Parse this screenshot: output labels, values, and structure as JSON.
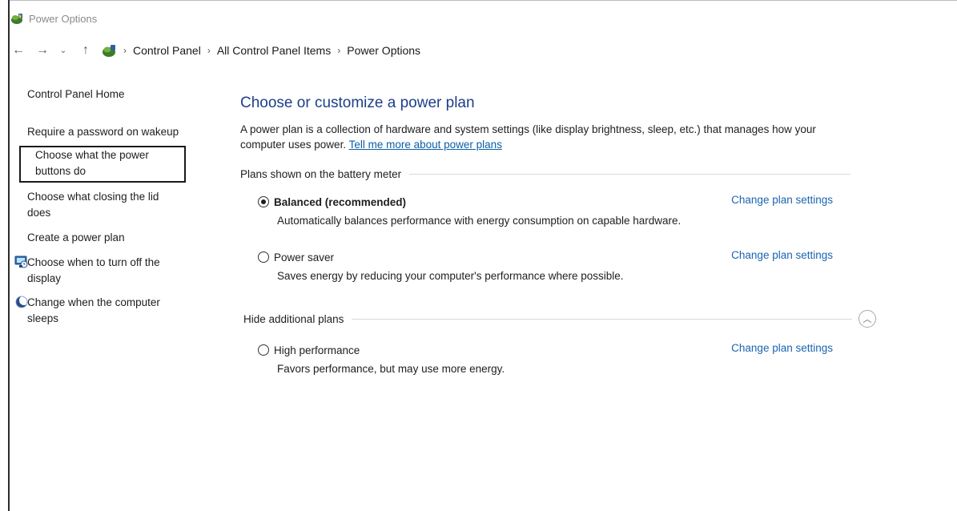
{
  "window": {
    "title": "Power Options",
    "icon": "power-options-icon"
  },
  "addressbar": {
    "back_icon": "←",
    "forward_icon": "→",
    "recent_icon": "⌄",
    "up_icon": "↑",
    "crumbs": [
      "Control Panel",
      "All Control Panel Items",
      "Power Options"
    ],
    "separator": "›"
  },
  "sidebar": {
    "home": "Control Panel Home",
    "items": [
      {
        "label_line1": "Require a password on wakeup",
        "label_line2": ""
      },
      {
        "label_line1": "Choose what the power",
        "label_line2": "buttons do"
      },
      {
        "label_line1": "Choose what closing the lid",
        "label_line2": "does"
      },
      {
        "label_line1": "Create a power plan",
        "label_line2": ""
      },
      {
        "label_line1": "Choose when to turn off the",
        "label_line2": "display",
        "icon": "display-icon"
      },
      {
        "label_line1": "Change when the computer",
        "label_line2": "sleeps",
        "icon": "sleep-moon-icon"
      }
    ]
  },
  "main": {
    "heading": "Choose or customize a power plan",
    "description": "A power plan is a collection of hardware and system settings (like display brightness, sleep, etc.) that manages how your computer uses power.",
    "description_link": "Tell me more about power plans",
    "group_battery": "Plans shown on the battery meter",
    "group_hidden": "Hide additional plans",
    "collapse_icon": "︿",
    "plans": [
      {
        "name": "Balanced (recommended)",
        "selected": true,
        "link": "Change plan settings",
        "desc": "Automatically balances performance with energy consumption on capable hardware."
      },
      {
        "name": "Power saver",
        "selected": false,
        "link": "Change plan settings",
        "desc": "Saves energy by reducing your computer's performance where possible."
      },
      {
        "name": "High performance",
        "selected": false,
        "link": "Change plan settings",
        "desc": "Favors performance, but may use more energy."
      }
    ]
  },
  "colors": {
    "heading": "#1c3f8a",
    "link": "#1a64b2"
  }
}
